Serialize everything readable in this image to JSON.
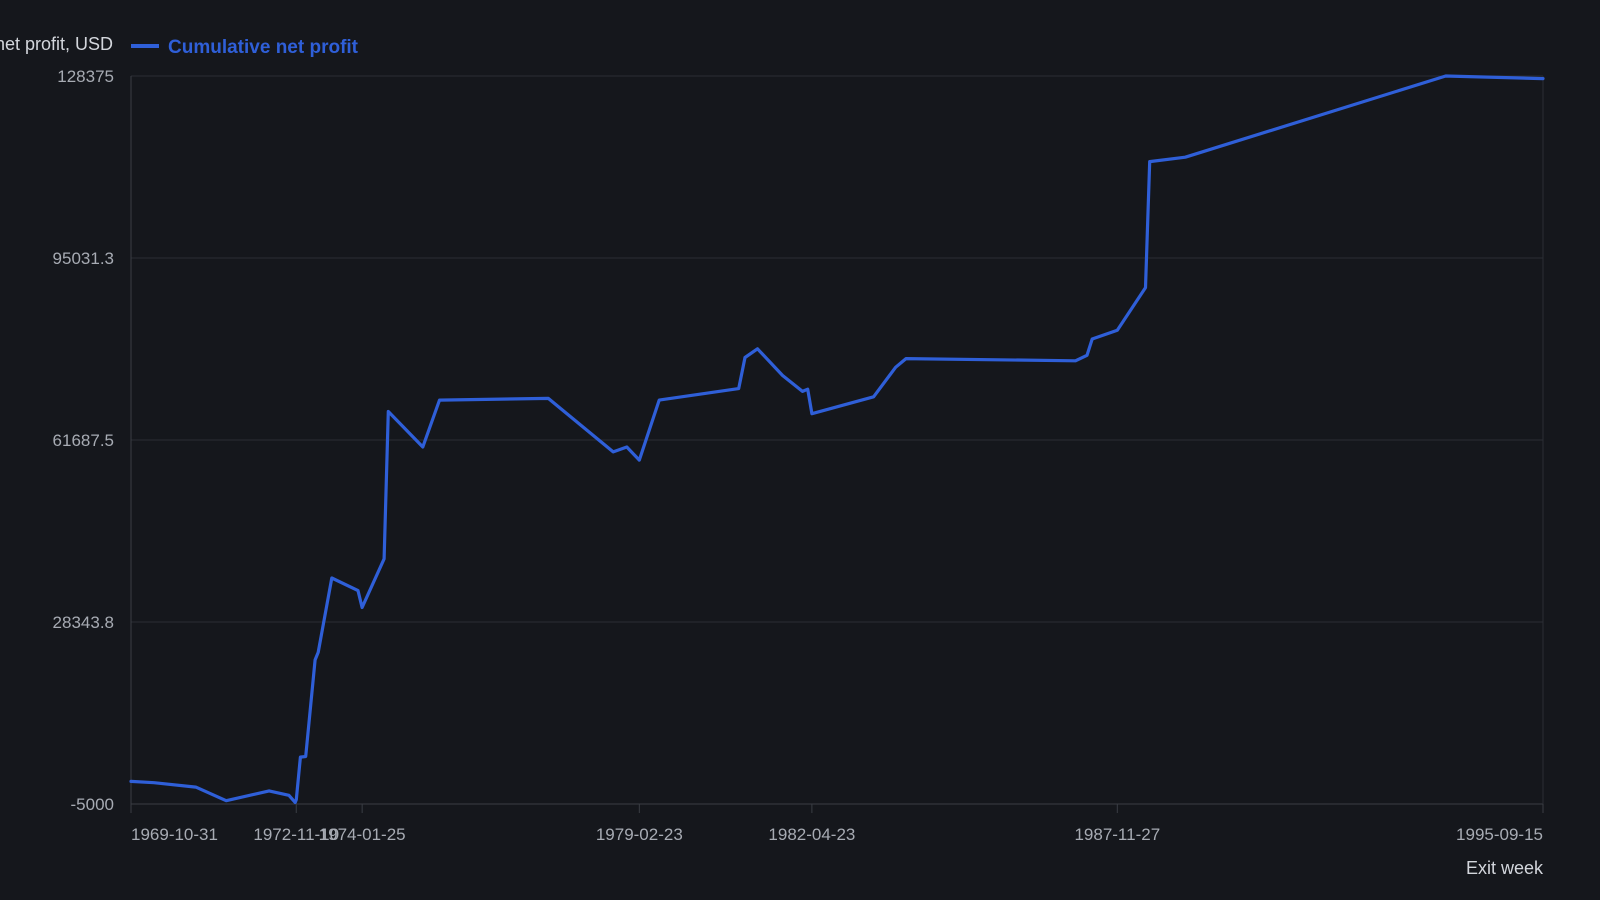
{
  "colors": {
    "background": "#15171c",
    "series": "#2f5fd8",
    "grid": "#2a2d34",
    "axis": "#3a3d44"
  },
  "chart_data": {
    "type": "line",
    "ylabel": "Cumulative net profit, USD",
    "xlabel": "Exit week",
    "ylim": [
      -5000,
      128375
    ],
    "yticks": [
      "128375",
      "95031.3",
      "61687.5",
      "28343.8",
      "-5000"
    ],
    "xlim": [
      "1969-10-31",
      "1995-09-15"
    ],
    "xticks": [
      "1969-10-31",
      "1972-11-10",
      "1974-01-25",
      "1979-02-23",
      "1982-04-23",
      "1987-11-27",
      "1995-09-15"
    ],
    "grid": true,
    "legend": "top-left",
    "series": [
      {
        "name": "Cumulative net profit",
        "points": [
          [
            "1969-10-31",
            -860
          ],
          [
            "1970-04-03",
            -1100
          ],
          [
            "1971-01-08",
            -1900
          ],
          [
            "1971-07-30",
            -4400
          ],
          [
            "1972-05-12",
            -2600
          ],
          [
            "1972-09-22",
            -3400
          ],
          [
            "1972-11-03",
            -4700
          ],
          [
            "1972-11-10",
            -4200
          ],
          [
            "1972-12-08",
            3600
          ],
          [
            "1973-01-12",
            3700
          ],
          [
            "1973-03-16",
            21400
          ],
          [
            "1973-04-06",
            22800
          ],
          [
            "1973-07-06",
            36400
          ],
          [
            "1973-12-28",
            34100
          ],
          [
            "1974-01-25",
            31000
          ],
          [
            "1974-06-21",
            39900
          ],
          [
            "1974-07-19",
            66900
          ],
          [
            "1975-03-07",
            60400
          ],
          [
            "1975-06-27",
            69000
          ],
          [
            "1977-06-24",
            69300
          ],
          [
            "1978-09-01",
            59500
          ],
          [
            "1978-12-01",
            60400
          ],
          [
            "1979-02-23",
            58000
          ],
          [
            "1979-07-06",
            69000
          ],
          [
            "1980-12-19",
            71100
          ],
          [
            "1981-01-30",
            76800
          ],
          [
            "1981-04-24",
            78400
          ],
          [
            "1981-10-09",
            73500
          ],
          [
            "1982-02-19",
            70600
          ],
          [
            "1982-03-26",
            71000
          ],
          [
            "1982-04-23",
            66500
          ],
          [
            "1983-06-10",
            69600
          ],
          [
            "1983-11-04",
            75000
          ],
          [
            "1984-01-13",
            76600
          ],
          [
            "1987-02-20",
            76200
          ],
          [
            "1987-05-08",
            77200
          ],
          [
            "1987-06-12",
            80200
          ],
          [
            "1987-11-27",
            81800
          ],
          [
            "1988-06-03",
            89600
          ],
          [
            "1988-07-01",
            112700
          ],
          [
            "1989-02-24",
            113500
          ],
          [
            "1993-12-03",
            128375
          ],
          [
            "1995-09-15",
            127900
          ]
        ]
      }
    ]
  }
}
